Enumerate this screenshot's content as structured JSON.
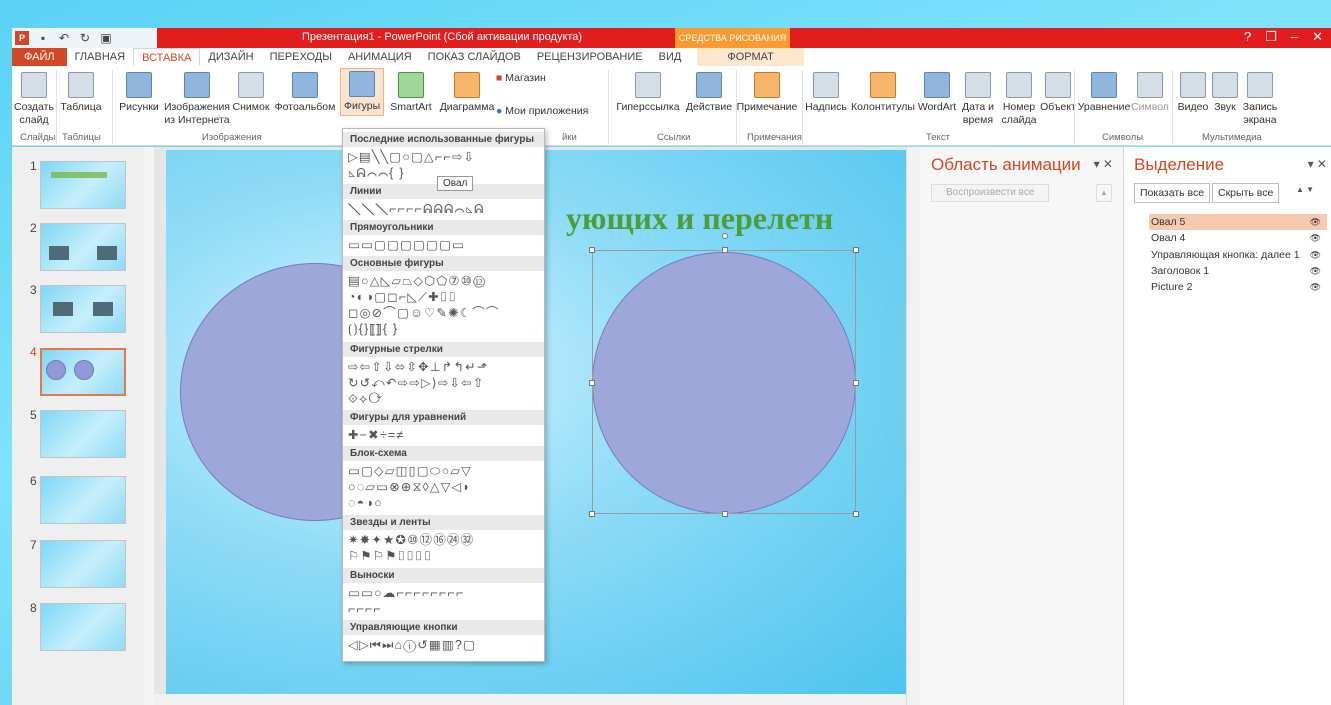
{
  "app": {
    "title": "Презентация1 - PowerPoint (Сбой активации продукта)",
    "drawing_tools": "СРЕДСТВА РИСОВАНИЯ",
    "help": "?",
    "minimize": "–",
    "restore": "❐",
    "close": "✕"
  },
  "tabs": [
    "ФАЙЛ",
    "ГЛАВНАЯ",
    "ВСТАВКА",
    "ДИЗАЙН",
    "ПЕРЕХОДЫ",
    "АНИМАЦИЯ",
    "ПОКАЗ СЛАЙДОВ",
    "РЕЦЕНЗИРОВАНИЕ",
    "ВИД",
    "ФОРМАТ"
  ],
  "ribbon": {
    "new_slide": "Создать слайд",
    "table": "Таблица",
    "pictures": "Рисунки",
    "online_pictures": "Изображения из Интернета",
    "screenshot": "Снимок",
    "photo_album": "Фотоальбом",
    "shapes": "Фигуры",
    "smartart": "SmartArt",
    "chart": "Диаграмма",
    "store": "Магазин",
    "my_apps": "Мои приложения",
    "hyperlink": "Гиперссылка",
    "action": "Действие",
    "comment": "Примечание",
    "textbox": "Надпись",
    "header_footer": "Колонтитулы",
    "wordart": "WordArt",
    "date_time": "Дата и время",
    "slide_number": "Номер слайда",
    "object": "Объект",
    "equation": "Уравнение",
    "symbol": "Символ",
    "video": "Видео",
    "audio": "Звук",
    "screen_recording": "Запись экрана",
    "groups": {
      "slides": "Слайды",
      "tables": "Таблицы",
      "images": "Изображения",
      "apps": "йки",
      "links": "Ссылки",
      "comments": "Примечания",
      "text": "Текст",
      "symbols": "Символы",
      "media": "Мультимедиа"
    }
  },
  "slides": {
    "numbers": [
      "1",
      "2",
      "3",
      "4",
      "5",
      "6",
      "7",
      "8"
    ],
    "active_index": 4
  },
  "slide": {
    "title_fragment": "ующих и перелетн"
  },
  "shapes_menu": {
    "recent": "Последние использованные фигуры",
    "lines": "Линии",
    "rectangles": "Прямоугольники",
    "basic": "Основные фигуры",
    "arrows": "Фигурные стрелки",
    "equation": "Фигуры для уравнений",
    "flowchart": "Блок-схема",
    "stars": "Звезды и ленты",
    "callouts": "Выноски",
    "action_buttons": "Управляющие кнопки",
    "tooltip": "Овал",
    "rows": {
      "recent1": "▷▤╲╲▢○▢△⌐⌐⇨⇩",
      "recent2": "◺ᕱ⌒⌒{ }",
      "lines1": "╲╲╲⌐⌐⌐⌐ᕱᕱᕱ⌒◺ᕱ",
      "rect1": "▭▭▢▢▢▢▢▢▭",
      "basic1": "▤○△◺▱⏢◇⬡⬠⑦⑩⑫",
      "basic2": "◔◐◑▢◻⌐◺⟋✚⌷⌷",
      "basic3": "◻◎⊘⌒▢☺♡✎✺☾⌒⌒",
      "basic4": "⟮⟯{}⟦⟧{ }",
      "arrows1": "⇨⇦⇧⇩⬄⇳✥⊥↱↰↵⬏",
      "arrows2": "↻↺⤺↶⇨⇨▷⟩⇨⇩⇦⇧",
      "arrows3": "⟐⟡⟳",
      "eq1": "✚−✖÷=≠",
      "flow1": "▭▢◇▱◫▯▢⬭○▱▽",
      "flow2": "○◌▱▭⊗⊕⧖◊△▽◁◗",
      "flow3": "◌◓◑○",
      "stars1": "✷✸✦★✪⑩⑫⑯㉔㉜",
      "stars2": "⚐⚑⚐⚑⌷⌷⌷⌷",
      "callouts1": "▭▭○☁⌐⌐⌐⌐⌐⌐⌐⌐",
      "callouts2": "⌐⌐⌐⌐",
      "buttons1": "◁▷⏮⏭⌂ⓘ↺▦▥?▢"
    }
  },
  "animation_pane": {
    "title": "Область анимации",
    "play_all": "Воспроизвести все"
  },
  "selection_pane": {
    "title": "Выделение",
    "show_all": "Показать все",
    "hide_all": "Скрыть все",
    "items": [
      "Овал 5",
      "Овал 4",
      "Управляющая кнопка: далее 1",
      "Заголовок 1",
      "Picture 2"
    ]
  }
}
